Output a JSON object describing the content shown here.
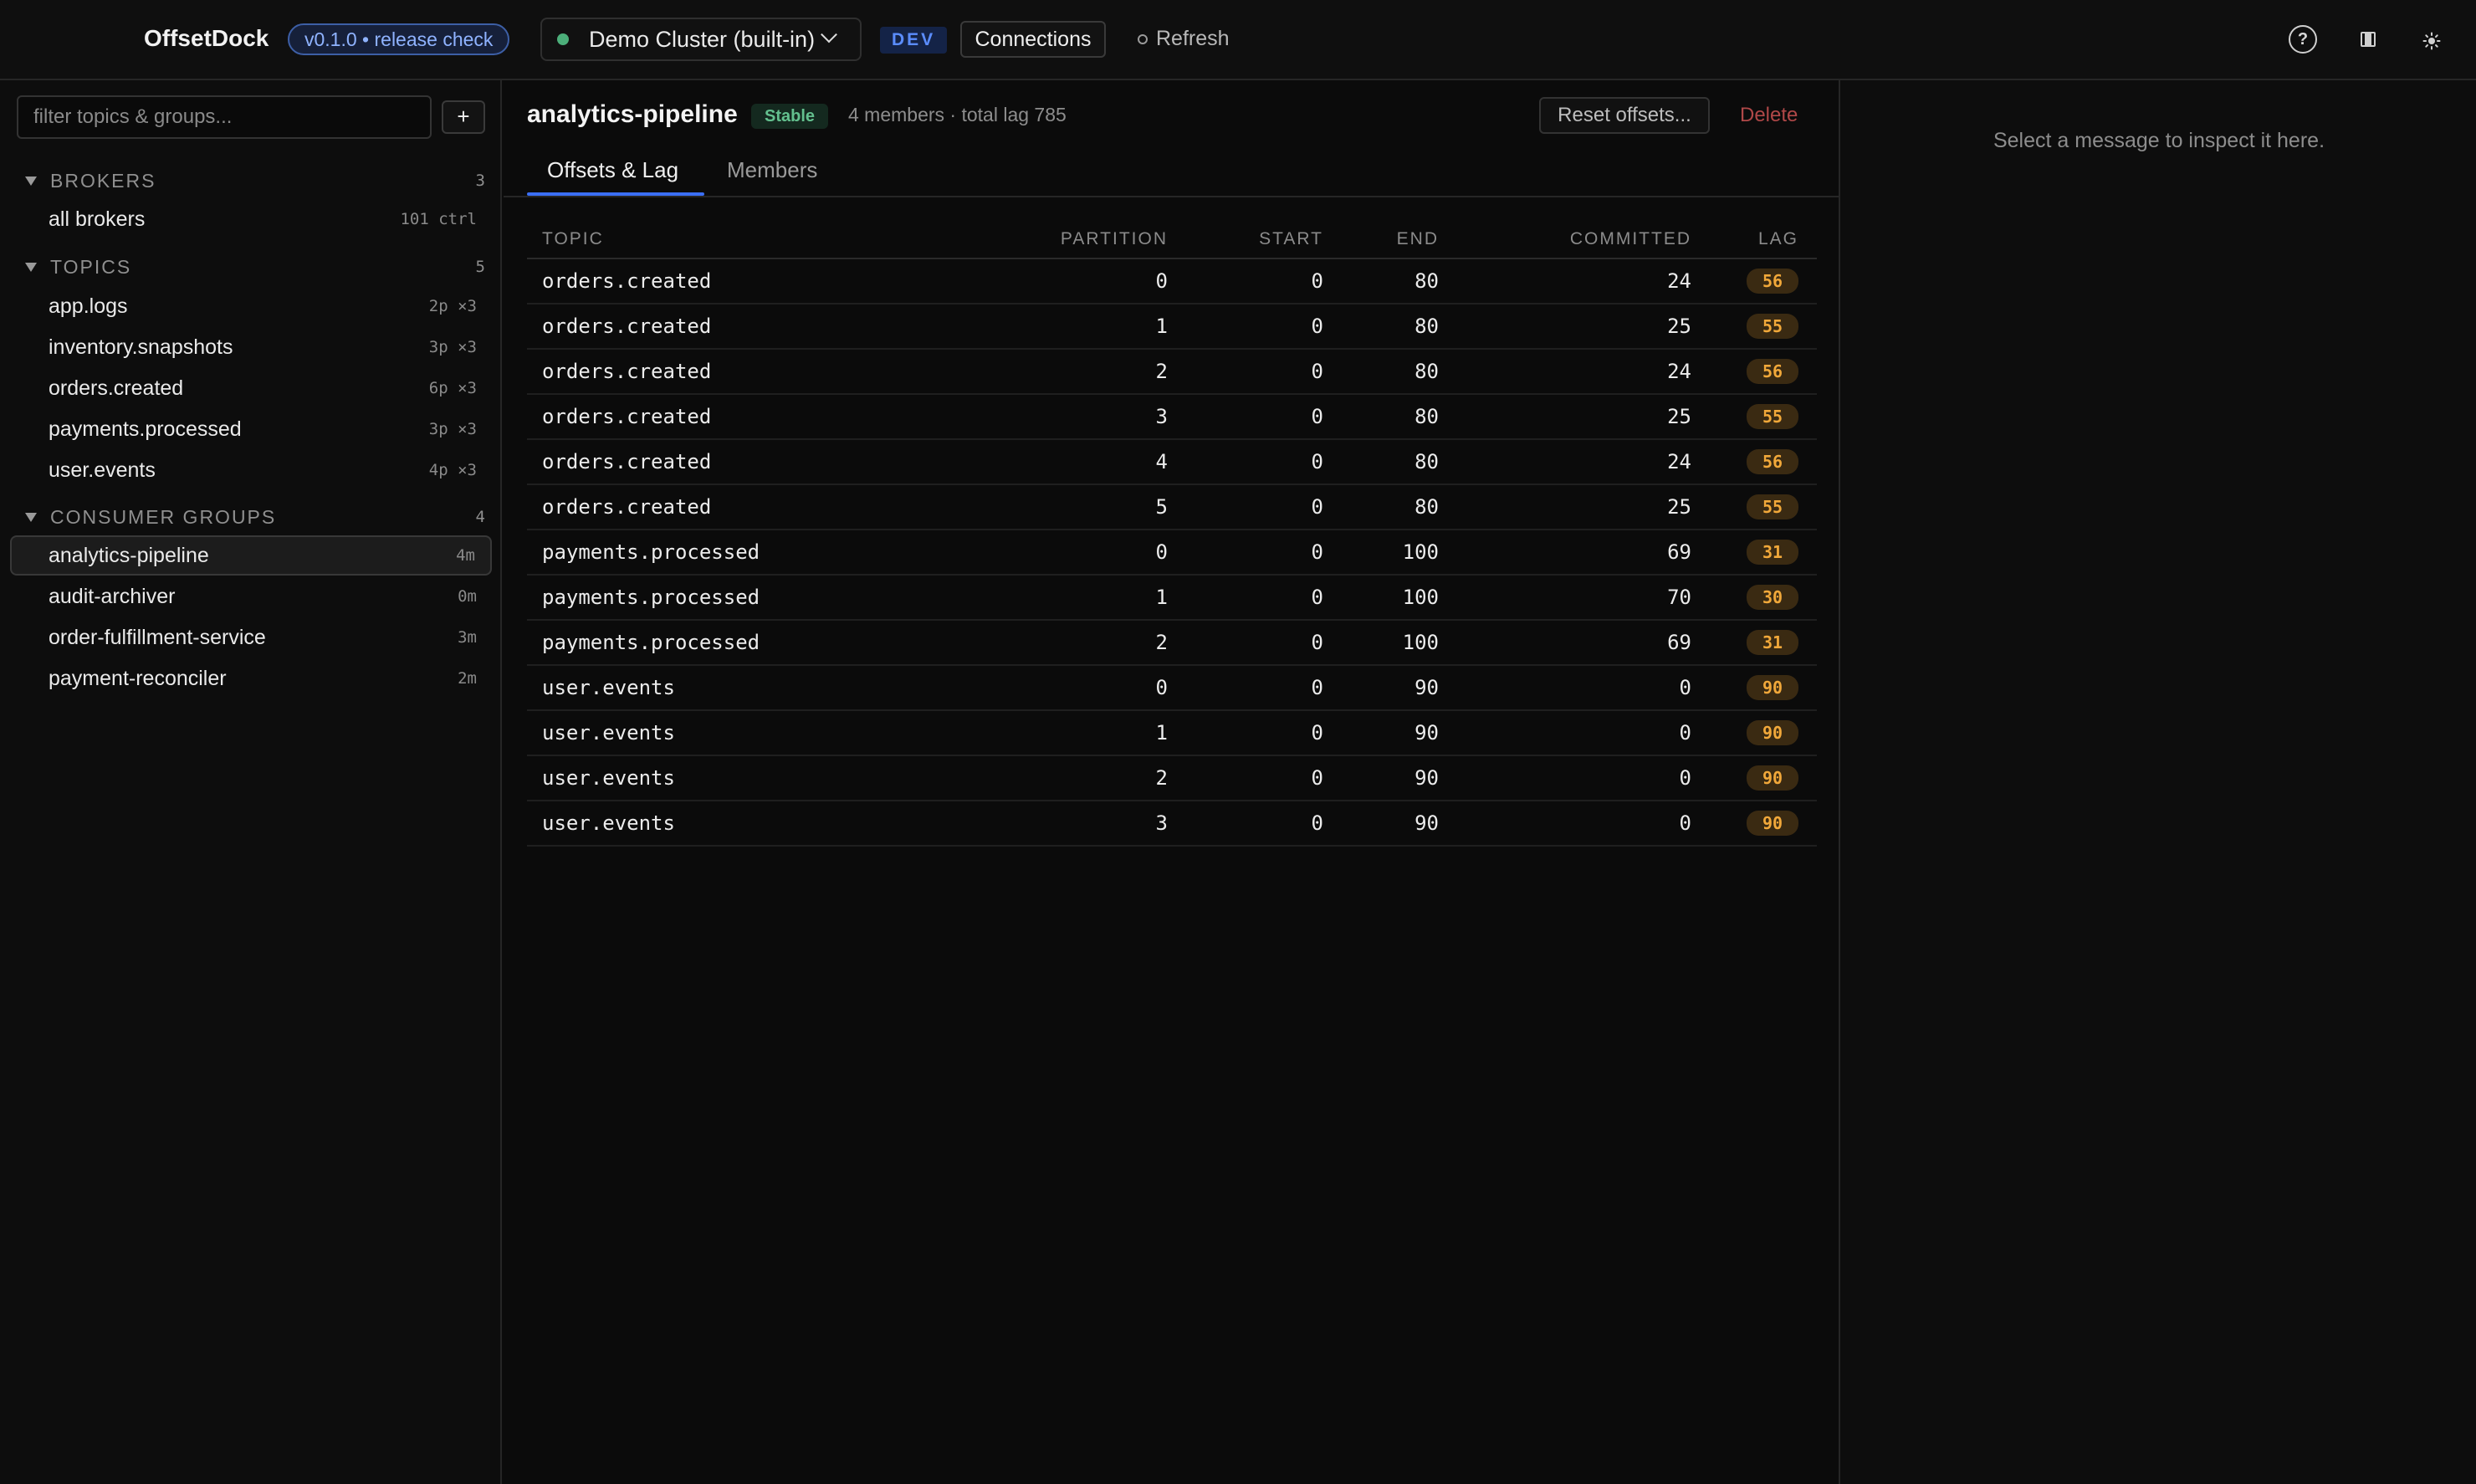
{
  "app": {
    "name": "OffsetDock",
    "version_label": "v0.1.0 • release check"
  },
  "topbar": {
    "cluster": "Demo Cluster (built-in)",
    "env": "DEV",
    "connections_label": "Connections",
    "refresh_label": "Refresh",
    "help_glyph": "?",
    "icons": [
      "help-icon",
      "panel-toggle-icon",
      "theme-sun-icon"
    ]
  },
  "sidebar": {
    "filter_placeholder": "filter topics & groups...",
    "add_label": "+",
    "brokers": {
      "title": "BROKERS",
      "count": "3",
      "items": [
        {
          "label": "all brokers",
          "meta": "101 ctrl"
        }
      ]
    },
    "topics": {
      "title": "TOPICS",
      "count": "5",
      "items": [
        {
          "label": "app.logs",
          "meta": "2p ×3"
        },
        {
          "label": "inventory.snapshots",
          "meta": "3p ×3"
        },
        {
          "label": "orders.created",
          "meta": "6p ×3"
        },
        {
          "label": "payments.processed",
          "meta": "3p ×3"
        },
        {
          "label": "user.events",
          "meta": "4p ×3"
        }
      ]
    },
    "groups": {
      "title": "CONSUMER GROUPS",
      "count": "4",
      "items": [
        {
          "label": "analytics-pipeline",
          "meta": "4m",
          "active": true
        },
        {
          "label": "audit-archiver",
          "meta": "0m"
        },
        {
          "label": "order-fulfillment-service",
          "meta": "3m"
        },
        {
          "label": "payment-reconciler",
          "meta": "2m"
        }
      ]
    }
  },
  "main": {
    "group_name": "analytics-pipeline",
    "state": "Stable",
    "summary": "4 members · total lag 785",
    "reset_label": "Reset offsets...",
    "delete_label": "Delete",
    "tabs": [
      {
        "label": "Offsets & Lag",
        "active": true
      },
      {
        "label": "Members",
        "active": false
      }
    ],
    "table": {
      "headers": [
        "TOPIC",
        "PARTITION",
        "START",
        "END",
        "COMMITTED",
        "LAG"
      ],
      "rows": [
        [
          "orders.created",
          "0",
          "0",
          "80",
          "24",
          "56"
        ],
        [
          "orders.created",
          "1",
          "0",
          "80",
          "25",
          "55"
        ],
        [
          "orders.created",
          "2",
          "0",
          "80",
          "24",
          "56"
        ],
        [
          "orders.created",
          "3",
          "0",
          "80",
          "25",
          "55"
        ],
        [
          "orders.created",
          "4",
          "0",
          "80",
          "24",
          "56"
        ],
        [
          "orders.created",
          "5",
          "0",
          "80",
          "25",
          "55"
        ],
        [
          "payments.processed",
          "0",
          "0",
          "100",
          "69",
          "31"
        ],
        [
          "payments.processed",
          "1",
          "0",
          "100",
          "70",
          "30"
        ],
        [
          "payments.processed",
          "2",
          "0",
          "100",
          "69",
          "31"
        ],
        [
          "user.events",
          "0",
          "0",
          "90",
          "0",
          "90"
        ],
        [
          "user.events",
          "1",
          "0",
          "90",
          "0",
          "90"
        ],
        [
          "user.events",
          "2",
          "0",
          "90",
          "0",
          "90"
        ],
        [
          "user.events",
          "3",
          "0",
          "90",
          "0",
          "90"
        ]
      ]
    }
  },
  "inspector": {
    "hint": "Select a message to inspect it here."
  },
  "colors": {
    "accent": "#3b6ff5",
    "lag": "#f1a83a",
    "stable": "#63c08e",
    "danger": "#b04848",
    "connected": "#4caf7a"
  }
}
